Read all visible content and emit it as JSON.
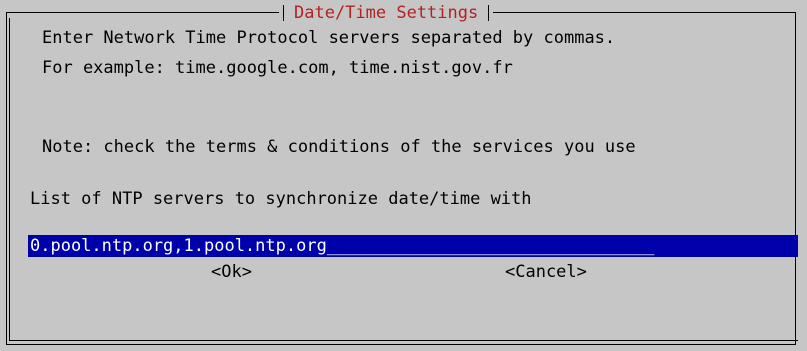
{
  "dialog": {
    "title": "Date/Time Settings",
    "description_line1": "Enter Network Time Protocol servers separated by commas.",
    "description_line2": "For example: time.google.com, time.nist.gov.fr",
    "note": "Note: check the terms & conditions of the services you use",
    "prompt": "List of NTP servers to synchronize date/time with",
    "input_value": "0.pool.ntp.org,1.pool.ntp.org",
    "input_fill": "________________________________",
    "ok_label": "<Ok>",
    "cancel_label": "<Cancel>"
  },
  "colors": {
    "background": "#c6c6c6",
    "title": "#b22222",
    "input_bg": "#0000aa",
    "input_fg": "#ffffff"
  }
}
